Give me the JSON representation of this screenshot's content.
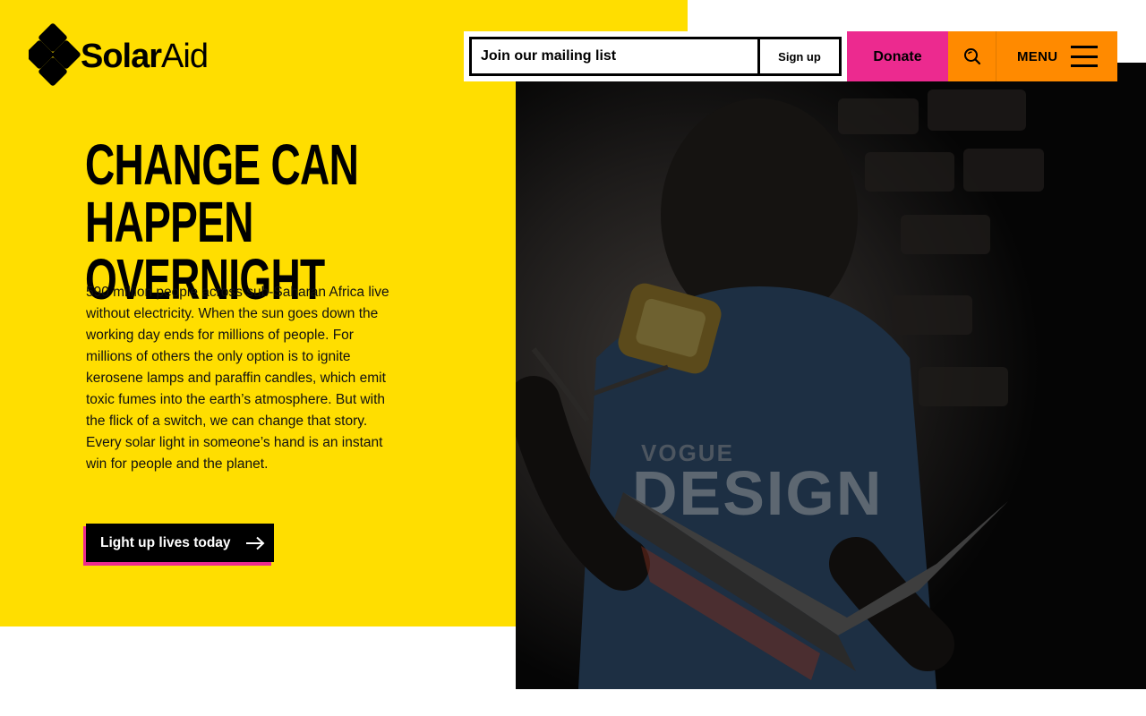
{
  "brand": {
    "name_bold": "Solar",
    "name_light": "Aid"
  },
  "header": {
    "mailing_placeholder": "Join our mailing list",
    "signup_label": "Sign up",
    "donate_label": "Donate",
    "menu_label": "MENU"
  },
  "hero": {
    "headline_line1": "CHANGE CAN HAPPEN",
    "headline_line2": "OVERNIGHT",
    "body": "590 million people across sub-Saharan Africa live without electricity. When the sun goes down the working day ends for millions of people. For millions of others the only option is to ignite kerosene lamps and paraffin candles, which emit toxic fumes into the earth’s atmosphere. But with the flick of a switch, we can change that story. Every solar light in someone’s hand is an instant win for people and the planet.",
    "cta_label": "Light up lives today"
  },
  "photo": {
    "shirt_text_1": "VOGUE",
    "shirt_text_2": "DESIGN"
  },
  "colors": {
    "yellow": "#ffde00",
    "pink": "#ec2a8f",
    "orange": "#ff8a00",
    "black": "#000000"
  },
  "icons": {
    "search": "search-icon",
    "menu": "hamburger-icon",
    "cta": "arrow-right-icon"
  }
}
